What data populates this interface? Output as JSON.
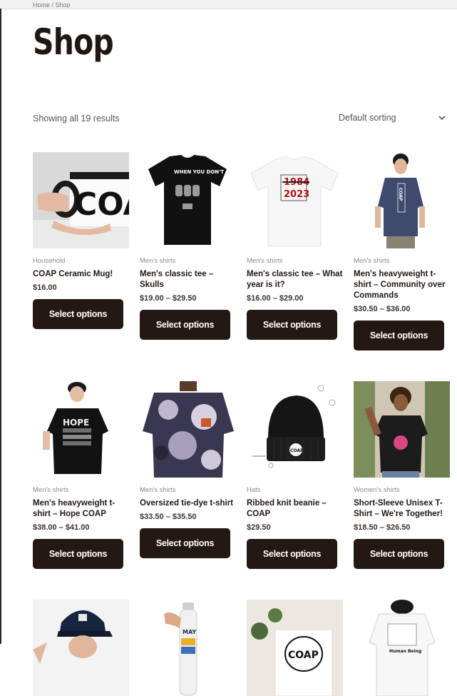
{
  "page": {
    "breadcrumb": "Home / Shop",
    "title": "Shop",
    "result_count": "Showing all 19 results",
    "sorting": {
      "selected": "Default sorting"
    }
  },
  "products": [
    {
      "category": "Household",
      "name": "COAP Ceramic Mug!",
      "price": "$16.00",
      "button": "Select options",
      "image": "mug-image"
    },
    {
      "category": "Men's shirts",
      "name": "Men's classic tee – Skulls",
      "price": "$19.00 – $29.50",
      "button": "Select options",
      "image": "black-tee-skulls-image"
    },
    {
      "category": "Men's shirts",
      "name": "Men's classic tee – What year is it?",
      "price": "$16.00 – $29.00",
      "button": "Select options",
      "image": "white-tee-2023-image"
    },
    {
      "category": "Men's shirts",
      "name": "Men's heavyweight t-shirt – Community over Commands",
      "price": "$30.50 – $36.00",
      "button": "Select options",
      "image": "navy-heavyweight-tee-image"
    },
    {
      "category": "Men's shirts",
      "name": "Men's heavyweight t-shirt – Hope COAP",
      "price": "$38.00 – $41.00",
      "button": "Select options",
      "image": "black-hope-tee-image"
    },
    {
      "category": "Men's shirts",
      "name": "Oversized tie-dye t-shirt",
      "price": "$33.50 – $35.50",
      "button": "Select options",
      "image": "tie-dye-tee-image"
    },
    {
      "category": "Hats",
      "name": "Ribbed knit beanie – COAP",
      "price": "$29.50",
      "button": "Select options",
      "image": "beanie-image"
    },
    {
      "category": "Women's shirts",
      "name": "Short-Sleeve Unisex T-Shirt – We're Together!",
      "price": "$18.50 – $26.50",
      "button": "Select options",
      "image": "unisex-tee-image"
    },
    {
      "category": "",
      "name": "",
      "price": "",
      "button": "",
      "image": "cap-image"
    },
    {
      "category": "",
      "name": "",
      "price": "",
      "button": "",
      "image": "water-bottle-image"
    },
    {
      "category": "",
      "name": "",
      "price": "",
      "button": "",
      "image": "poster-image"
    },
    {
      "category": "",
      "name": "",
      "price": "",
      "button": "",
      "image": "hoodie-image"
    }
  ],
  "thumb_text": {
    "mug": "COA",
    "tee_skulls": "WHEN YOU DON'T",
    "year_old": "1984",
    "year_new": "2023",
    "vertical_coap": "COAP",
    "hope": "HOPE",
    "beanie": "COAP",
    "bottle": "MAY",
    "poster": "COAP",
    "hoodie": "Human Being"
  },
  "colors": {
    "button_bg": "#231814",
    "title": "#1f1714",
    "category": "#8a8a8a"
  }
}
